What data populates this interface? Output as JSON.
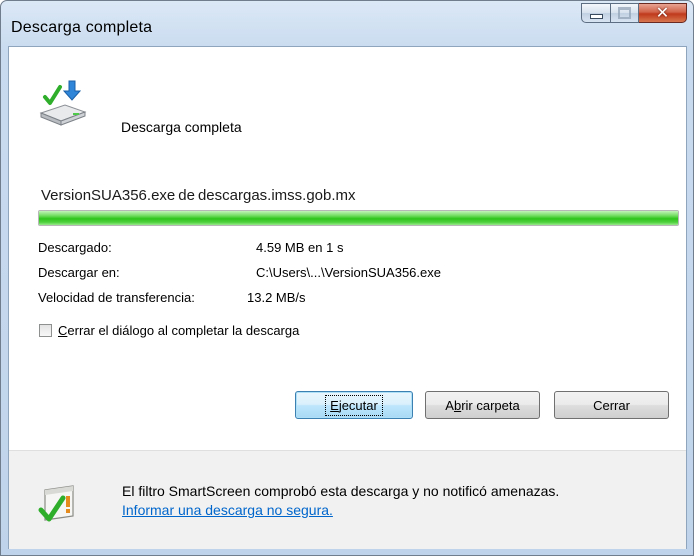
{
  "window": {
    "title": "Descarga completa"
  },
  "icons": {
    "download": "download-complete-icon",
    "shield": "smartscreen-icon"
  },
  "heading": "Descarga completa",
  "file": {
    "name": "VersionSUA356.exe",
    "sep": "de",
    "source": "descargas.imss.gob.mx"
  },
  "progress": {
    "percent": 100,
    "color": "#2fc41c"
  },
  "info": {
    "downloaded_label": "Descargado:",
    "downloaded_value": "4.59 MB en 1 s",
    "saveto_label": "Descargar en:",
    "saveto_value": "C:\\Users\\...\\VersionSUA356.exe",
    "speed_label": "Velocidad de transferencia:",
    "speed_value": "13.2 MB/s"
  },
  "checkbox": {
    "label_accel": "C",
    "label_rest": "errar el diálogo al completar la descarga",
    "checked": false
  },
  "buttons": {
    "run_accel": "E",
    "run_rest": "jecutar",
    "open_pre": "A",
    "open_accel": "b",
    "open_rest": "rir carpeta",
    "close": "Cerrar"
  },
  "smartscreen": {
    "message": "El filtro SmartScreen comprobó esta descarga y no notificó amenazas.",
    "link": "Informar una descarga no segura."
  }
}
